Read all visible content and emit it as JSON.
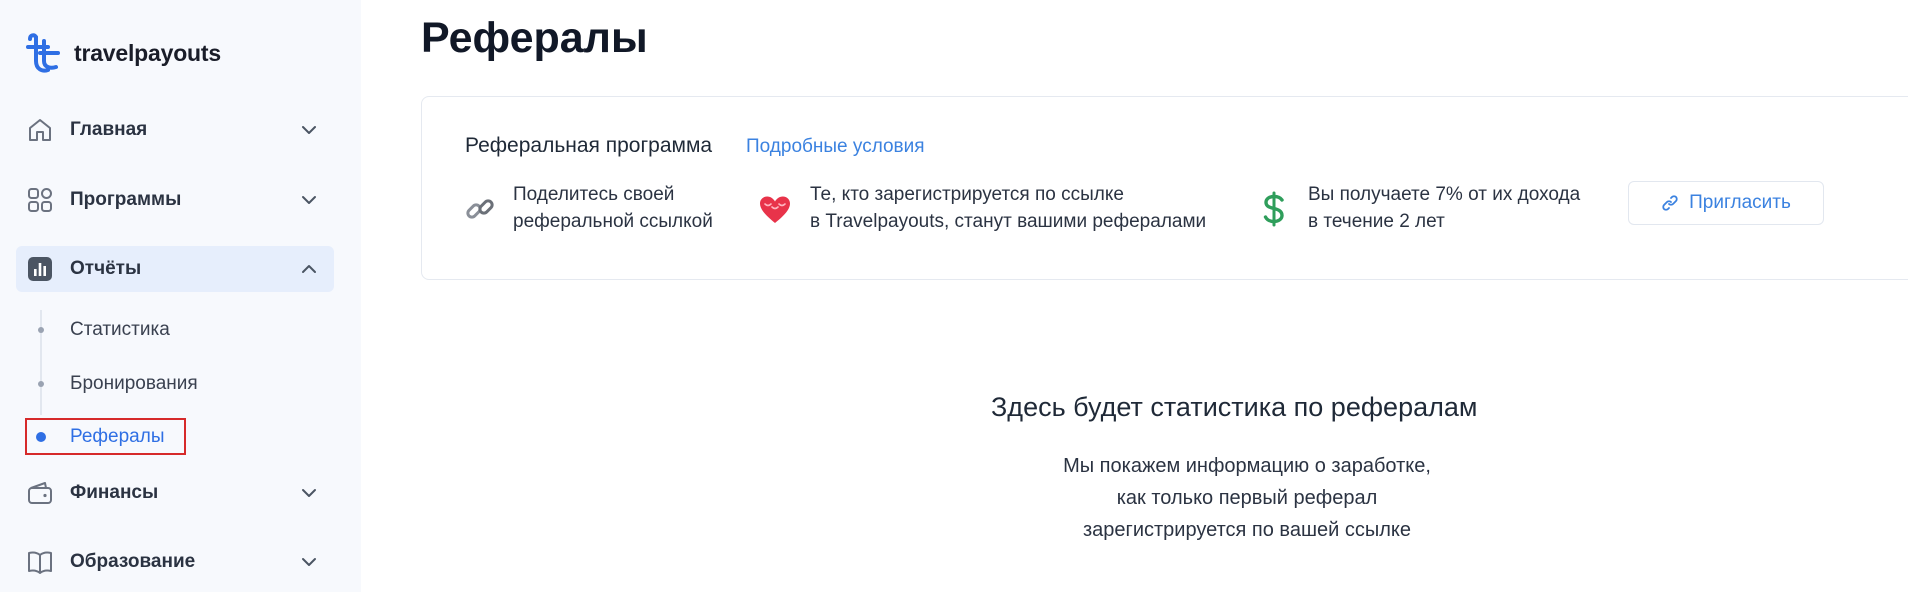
{
  "brand": {
    "name": "travelpayouts",
    "color": "#2f6fe4"
  },
  "sidebar": {
    "items": [
      {
        "label": "Главная",
        "icon": "home-icon"
      },
      {
        "label": "Программы",
        "icon": "grid-icon"
      },
      {
        "label": "Отчёты",
        "icon": "bar-chart-icon",
        "expanded": true
      },
      {
        "label": "Финансы",
        "icon": "wallet-icon"
      },
      {
        "label": "Образование",
        "icon": "book-icon"
      }
    ],
    "reports_sub": [
      {
        "label": "Статистика"
      },
      {
        "label": "Бронирования"
      },
      {
        "label": "Рефералы",
        "active": true
      }
    ]
  },
  "page": {
    "title": "Рефералы"
  },
  "referral_card": {
    "title": "Реферальная программа",
    "details_link": "Подробные условия",
    "features": [
      {
        "icon": "link-icon",
        "line1": "Поделитесь своей",
        "line2": "реферальной ссылкой"
      },
      {
        "icon": "heart-icon",
        "line1": "Те, кто зарегистрируется по ссылке",
        "line2": "в Travelpayouts, станут вашими рефералами"
      },
      {
        "icon": "dollar-icon",
        "line1": "Вы получаете 7% от их дохода",
        "line2": "в течение 2 лет"
      }
    ],
    "invite_label": "Пригласить"
  },
  "empty_state": {
    "title": "Здесь будет статистика по рефералам",
    "line1": "Мы покажем информацию о заработке,",
    "line2": "как только первый реферал",
    "line3": "зарегистрируется по вашей ссылке"
  }
}
